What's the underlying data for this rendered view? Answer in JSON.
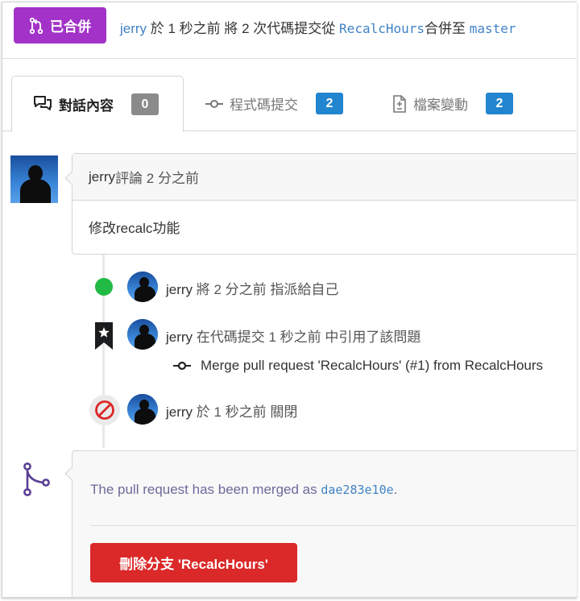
{
  "header": {
    "status_badge": "已合併",
    "user": "jerry",
    "text_1": " 於 1 秒之前 將 2 次代碼提交從 ",
    "source_branch": "RecalcHours",
    "text_2": "合併至 ",
    "target_branch": "master",
    "badge_color": "#a333c8"
  },
  "tabs": [
    {
      "label": "對話內容",
      "count": "0",
      "icon": "comments-icon"
    },
    {
      "label": "程式碼提交",
      "count": "2",
      "icon": "commit-icon"
    },
    {
      "label": "檔案變動",
      "count": "2",
      "icon": "file-diff-icon"
    }
  ],
  "comment": {
    "user": "jerry",
    "meta": " 評論 2 分之前",
    "body": "修改recalc功能"
  },
  "events": [
    {
      "user": "jerry",
      "text": " 將 2 分之前 指派給自己",
      "icon": "green-dot-icon"
    },
    {
      "user": "jerry",
      "text": " 在代碼提交 1 秒之前 中引用了該問題",
      "icon": "bookmark-star-icon"
    },
    {
      "commit_message": "Merge pull request 'RecalcHours' (#1) from RecalcHours",
      "icon": "commit-icon"
    },
    {
      "user": "jerry",
      "text": " 於 1 秒之前 關閉",
      "icon": "ban-icon"
    }
  ],
  "merge": {
    "message_prefix": "The pull request has been merged as ",
    "sha": "dae283e10e",
    "message_suffix": ".",
    "delete_button_label": "刪除分支 'RecalcHours'",
    "icon": "merge-icon",
    "button_color": "#db2828"
  }
}
